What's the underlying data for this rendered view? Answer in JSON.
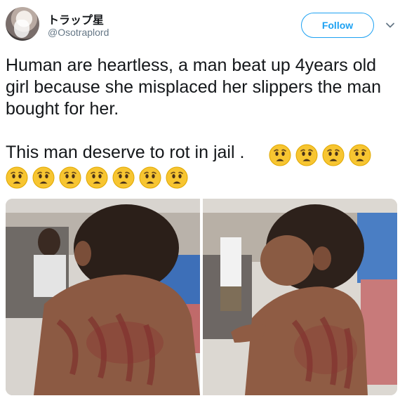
{
  "user": {
    "display_name": "トラップ星",
    "handle": "@Osotraplord"
  },
  "follow_label": "Follow",
  "tweet": {
    "line1": "Human are heartless, a man beat up 4years old girl because she misplaced her slippers the man bought for her.",
    "line2": "This man deserve to rot in jail ."
  },
  "emoji": {
    "name": "anguished-face-icon",
    "count": 11,
    "row1_count": 4,
    "row2_count": 7
  },
  "colors": {
    "accent": "#1da1f2",
    "text": "#14171a",
    "secondary": "#657786",
    "emoji_face": "#f7c531"
  },
  "photos": [
    {
      "name": "photo-girl-back"
    },
    {
      "name": "photo-girl-side"
    }
  ]
}
